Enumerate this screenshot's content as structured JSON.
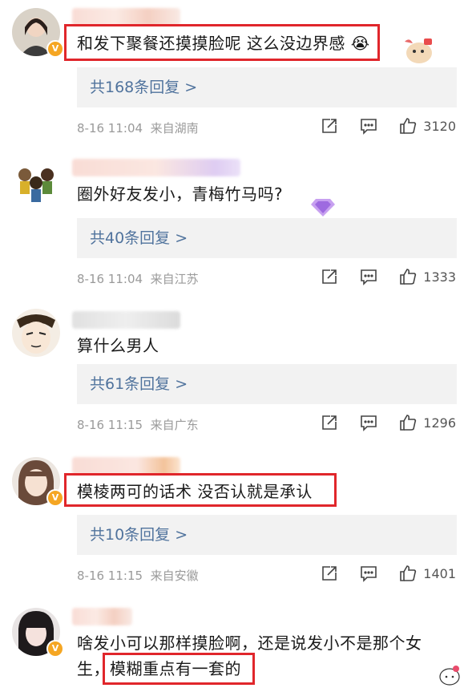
{
  "comments": [
    {
      "text": "和发下聚餐还摸摸脸呢 这么没边界感",
      "emoji": "😭",
      "replies": "共168条回复 >",
      "time": "8-16 11:04",
      "location": "来自湖南",
      "likes": "3120"
    },
    {
      "text": "圈外好友发小，青梅竹马吗?",
      "replies": "共40条回复 >",
      "time": "8-16 11:04",
      "location": "来自江苏",
      "likes": "1333"
    },
    {
      "text": "算什么男人",
      "replies": "共61条回复 >",
      "time": "8-16 11:15",
      "location": "来自广东",
      "likes": "1296"
    },
    {
      "text": "模棱两可的话术 没否认就是承认",
      "replies": "共10条回复 >",
      "time": "8-16 11:15",
      "location": "来自安徽",
      "likes": "1401"
    },
    {
      "text_line1": "啥发小可以那样摸脸啊，还是说发小不是那个女",
      "text_line2_a": "生，",
      "text_line2_b": "模糊重点有一套的"
    }
  ],
  "colors": {
    "highlight": "#e0262b",
    "reply_link": "#50739d",
    "reply_bg": "#f2f2f2",
    "meta": "#9a9a9a",
    "verified_badge": "#f5a623"
  },
  "icons": [
    "share-icon",
    "comment-icon",
    "like-icon",
    "verified-badge-icon"
  ]
}
